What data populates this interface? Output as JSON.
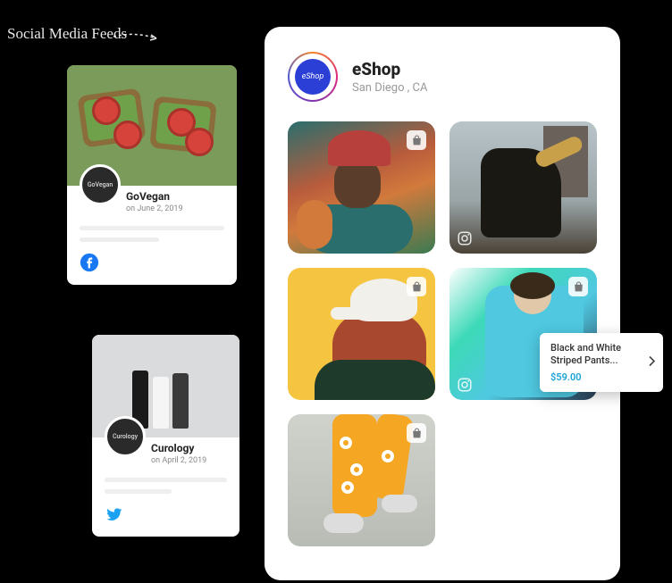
{
  "label": "Social Media Feeds",
  "feed1": {
    "name": "GoVegan",
    "avatar_text": "GoVegan",
    "date": "on June 2, 2019",
    "platform": "facebook"
  },
  "feed2": {
    "name": "Curology",
    "avatar_text": "Curology",
    "date": "on April 2, 2019",
    "platform": "twitter"
  },
  "profile": {
    "name": "eShop",
    "avatar_text": "eShop",
    "location": "San Diego , CA"
  },
  "popup": {
    "title": "Black and White Striped Pants...",
    "price": "$59.00"
  }
}
